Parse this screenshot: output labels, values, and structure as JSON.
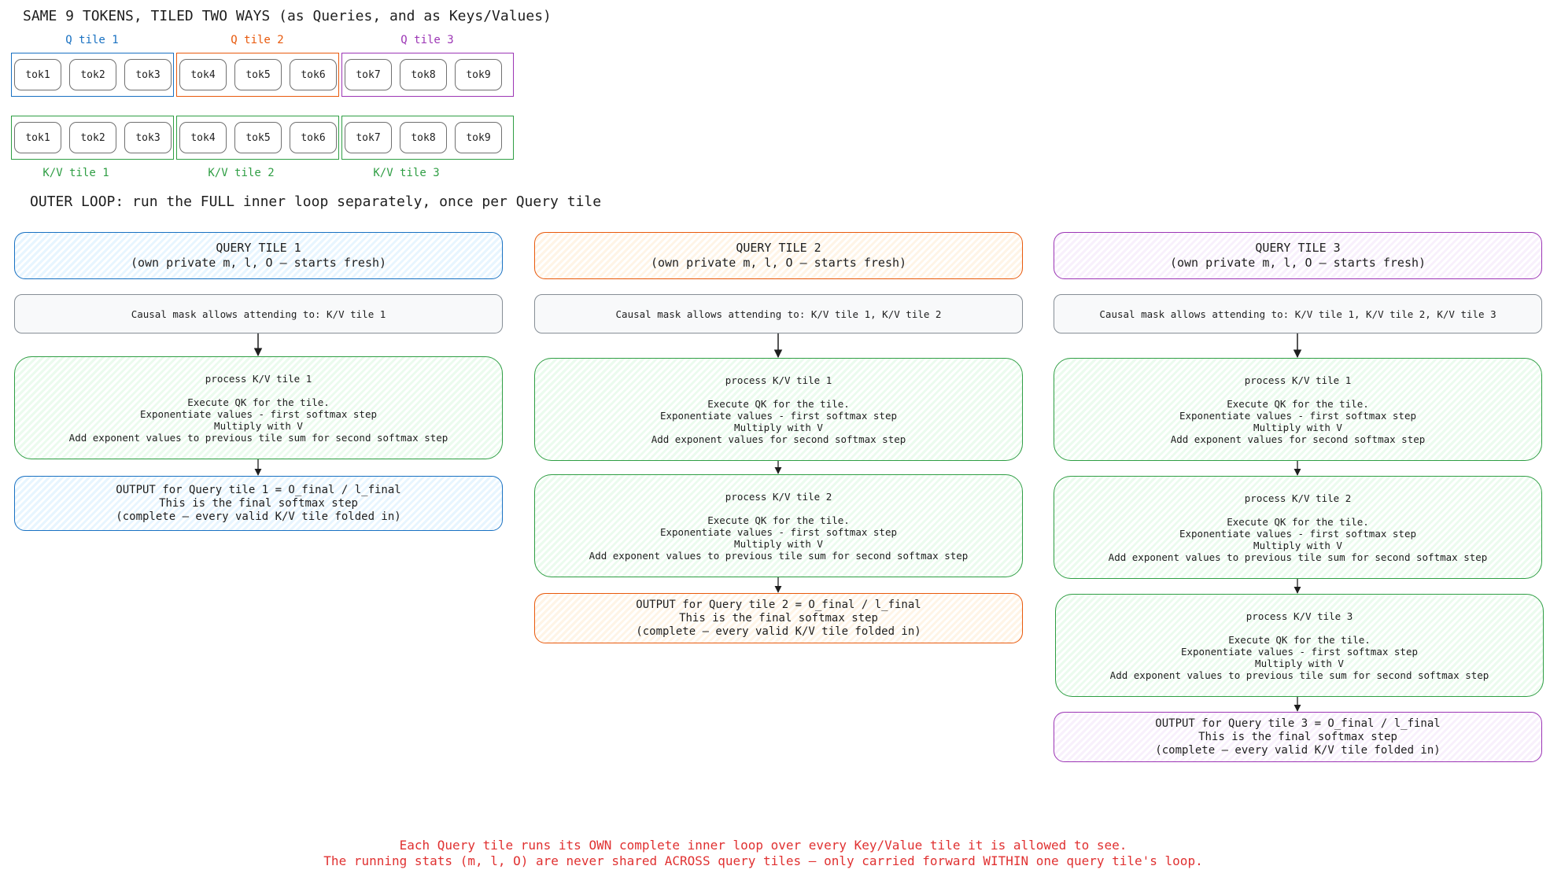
{
  "title": "SAME 9 TOKENS, TILED TWO WAYS (as Queries, and as Keys/Values)",
  "q_tile_labels": [
    "Q tile 1",
    "Q tile 2",
    "Q tile 3"
  ],
  "q_tokens": [
    "tok1",
    "tok2",
    "tok3",
    "tok4",
    "tok5",
    "tok6",
    "tok7",
    "tok8",
    "tok9"
  ],
  "kv_tokens": [
    "tok1",
    "tok2",
    "tok3",
    "tok4",
    "tok5",
    "tok6",
    "tok7",
    "tok8",
    "tok9"
  ],
  "kv_tile_labels": [
    "K/V tile 1",
    "K/V tile 2",
    "K/V tile 3"
  ],
  "outer_loop_heading": "OUTER LOOP: run the FULL inner loop separately, once per Query tile",
  "colors": {
    "tile1": "#1971c2",
    "tile2": "#e8590c",
    "tile3": "#9c36b5",
    "kv": "#2f9e44",
    "footer": "#e03131",
    "mask_border": "#868e96"
  },
  "columns": [
    {
      "query_title": "QUERY TILE 1",
      "query_sub": "(own private m, l, O — starts fresh)",
      "mask": "Causal mask allows attending to: K/V tile 1",
      "steps": [
        {
          "title": "process K/V tile 1",
          "lines": [
            "Execute QK for the tile.",
            "Exponentiate values - first softmax step",
            "Multiply with V",
            "Add exponent values to previous tile sum for second softmax step"
          ]
        }
      ],
      "output": [
        "OUTPUT for Query tile 1 = O_final / l_final",
        "This is the final softmax step",
        "(complete — every valid K/V tile folded in)"
      ]
    },
    {
      "query_title": "QUERY TILE 2",
      "query_sub": "(own private m, l, O — starts fresh)",
      "mask": "Causal mask allows attending to: K/V tile 1, K/V tile 2",
      "steps": [
        {
          "title": "process K/V tile 1",
          "lines": [
            "Execute QK for the tile.",
            "Exponentiate values - first softmax step",
            "Multiply with V",
            "Add exponent values for second softmax step"
          ]
        },
        {
          "title": "process K/V tile 2",
          "lines": [
            "Execute QK for the tile.",
            "Exponentiate values - first softmax step",
            "Multiply with V",
            "Add exponent values to previous tile sum for second softmax step"
          ]
        }
      ],
      "output": [
        "OUTPUT for Query tile 2 = O_final / l_final",
        "This is the final softmax step",
        "(complete — every valid K/V tile folded in)"
      ]
    },
    {
      "query_title": "QUERY TILE 3",
      "query_sub": "(own private m, l, O — starts fresh)",
      "mask": "Causal mask allows attending to: K/V tile 1, K/V tile 2, K/V tile 3",
      "steps": [
        {
          "title": "process K/V tile 1",
          "lines": [
            "Execute QK for the tile.",
            "Exponentiate values - first softmax step",
            "Multiply with V",
            "Add exponent values for second softmax step"
          ]
        },
        {
          "title": "process K/V tile 2",
          "lines": [
            "Execute QK for the tile.",
            "Exponentiate values - first softmax step",
            "Multiply with V",
            "Add exponent values to previous tile sum for second softmax step"
          ]
        },
        {
          "title": "process K/V tile 3",
          "lines": [
            "Execute QK for the tile.",
            "Exponentiate values - first softmax step",
            "Multiply with V",
            "Add exponent values to previous tile sum for second softmax step"
          ]
        }
      ],
      "output": [
        "OUTPUT for Query tile 3 = O_final / l_final",
        "This is the final softmax step",
        "(complete — every valid K/V tile folded in)"
      ]
    }
  ],
  "footer": [
    "Each Query tile runs its OWN complete inner loop over every Key/Value tile it is allowed to see.",
    "The running stats (m, l, O) are never shared ACROSS query tiles — only carried forward WITHIN one query tile's loop."
  ]
}
